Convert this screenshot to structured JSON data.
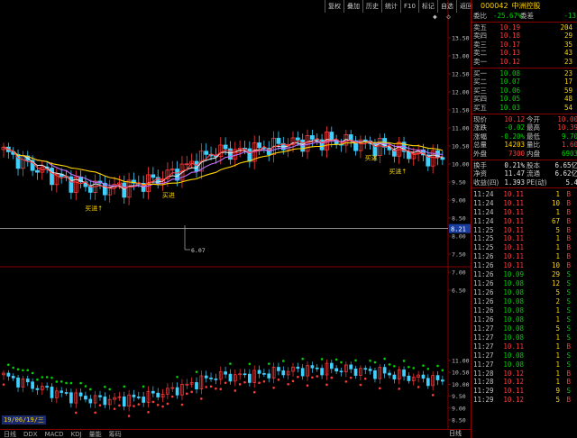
{
  "toolbar": [
    "复权",
    "叠加",
    "历史",
    "统计",
    "F10",
    "标记",
    "自选",
    "返回"
  ],
  "toolbar_icons": [
    "diamond-icon",
    "diamond-outline-icon"
  ],
  "stock": {
    "code": "000042",
    "name": "中洲控股"
  },
  "weibi": {
    "label": "委比",
    "value": "-25.67%",
    "label2": "委差",
    "value2": "-13"
  },
  "asks": [
    {
      "label": "卖五",
      "price": "10.19",
      "vol": "204"
    },
    {
      "label": "卖四",
      "price": "10.18",
      "vol": "29"
    },
    {
      "label": "卖三",
      "price": "10.17",
      "vol": "35"
    },
    {
      "label": "卖二",
      "price": "10.13",
      "vol": "43"
    },
    {
      "label": "卖一",
      "price": "10.12",
      "vol": "23"
    }
  ],
  "bids": [
    {
      "label": "买一",
      "price": "10.08",
      "vol": "23"
    },
    {
      "label": "买二",
      "price": "10.07",
      "vol": "17"
    },
    {
      "label": "买三",
      "price": "10.06",
      "vol": "59"
    },
    {
      "label": "买四",
      "price": "10.05",
      "vol": "48"
    },
    {
      "label": "买五",
      "price": "10.03",
      "vol": "54"
    }
  ],
  "stats": [
    [
      {
        "label": "现价",
        "value": "10.12",
        "cls": "up"
      },
      {
        "label": "今开",
        "value": "10.00",
        "cls": "up"
      }
    ],
    [
      {
        "label": "涨跌",
        "value": "-0.02",
        "cls": "dn"
      },
      {
        "label": "最高",
        "value": "10.39",
        "cls": "up"
      }
    ],
    [
      {
        "label": "涨幅",
        "value": "-0.20%",
        "cls": "dn"
      },
      {
        "label": "最低",
        "value": "9.70",
        "cls": "dn"
      }
    ],
    [
      {
        "label": "总量",
        "value": "14203",
        "cls": "yel"
      },
      {
        "label": "量比",
        "value": "1.60",
        "cls": "up"
      }
    ],
    [
      {
        "label": "外盘",
        "value": "7300",
        "cls": "up"
      },
      {
        "label": "内盘",
        "value": "6903",
        "cls": "dn"
      }
    ]
  ],
  "stats2": [
    [
      {
        "label": "换手",
        "value": "0.21%",
        "cls": "wht"
      },
      {
        "label": "股本",
        "value": "6.65亿",
        "cls": "wht"
      }
    ],
    [
      {
        "label": "净资",
        "value": "11.47",
        "cls": "wht"
      },
      {
        "label": "流通",
        "value": "6.62亿",
        "cls": "wht"
      }
    ],
    [
      {
        "label": "收益(四)",
        "value": "1.393",
        "cls": "wht"
      },
      {
        "label": "PE(动)",
        "value": "5.4",
        "cls": "wht"
      }
    ]
  ],
  "ticks": [
    [
      "11:24",
      "10.11",
      "1",
      "B"
    ],
    [
      "11:24",
      "10.11",
      "10",
      "B"
    ],
    [
      "11:24",
      "10.11",
      "1",
      "B"
    ],
    [
      "11:24",
      "10.11",
      "67",
      "B"
    ],
    [
      "11:25",
      "10.11",
      "5",
      "B"
    ],
    [
      "11:25",
      "10.11",
      "1",
      "B"
    ],
    [
      "11:25",
      "10.11",
      "1",
      "B"
    ],
    [
      "11:26",
      "10.11",
      "1",
      "B"
    ],
    [
      "11:26",
      "10.11",
      "10",
      "B"
    ],
    [
      "11:26",
      "10.09",
      "29",
      "S"
    ],
    [
      "11:26",
      "10.08",
      "12",
      "S"
    ],
    [
      "11:26",
      "10.08",
      "5",
      "S"
    ],
    [
      "11:26",
      "10.08",
      "2",
      "S"
    ],
    [
      "11:26",
      "10.08",
      "1",
      "S"
    ],
    [
      "11:26",
      "10.08",
      "1",
      "S"
    ],
    [
      "11:27",
      "10.08",
      "5",
      "S"
    ],
    [
      "11:27",
      "10.08",
      "1",
      "S"
    ],
    [
      "11:27",
      "10.11",
      "1",
      "B"
    ],
    [
      "11:27",
      "10.08",
      "1",
      "S"
    ],
    [
      "11:27",
      "10.08",
      "1",
      "S"
    ],
    [
      "11:28",
      "10.12",
      "1",
      "B"
    ],
    [
      "11:28",
      "10.12",
      "1",
      "B"
    ],
    [
      "11:29",
      "10.11",
      "9",
      "S"
    ],
    [
      "11:29",
      "10.12",
      "5",
      "B"
    ]
  ],
  "price_axis": [
    "13.50",
    "13.00",
    "12.50",
    "12.00",
    "11.50",
    "11.00",
    "10.50",
    "10.00",
    "9.50",
    "9.00",
    "8.50",
    "8.00",
    "7.50",
    "7.00",
    "6.50"
  ],
  "cursor_price": "8.21",
  "low_marker": "6.07",
  "buy_signals": [
    "买进↑",
    "买进",
    "买进",
    "买进↑"
  ],
  "indicator_axis": [
    "11.00",
    "10.50",
    "10.00",
    "9.50",
    "9.00",
    "8.50"
  ],
  "date_tag": "19/06/19/三",
  "bottom_tabs": [
    "日线",
    "DDX",
    "MACD",
    "KDJ",
    "量能",
    "筹码"
  ],
  "bottom_right": "日线",
  "colors": {
    "up": "#ff3b3b",
    "down": "#00d200",
    "ma_yellow": "#ffd400",
    "ma_white": "#e0e0e0",
    "ma_purple": "#c070ff",
    "signal_text": "#ffd400"
  }
}
